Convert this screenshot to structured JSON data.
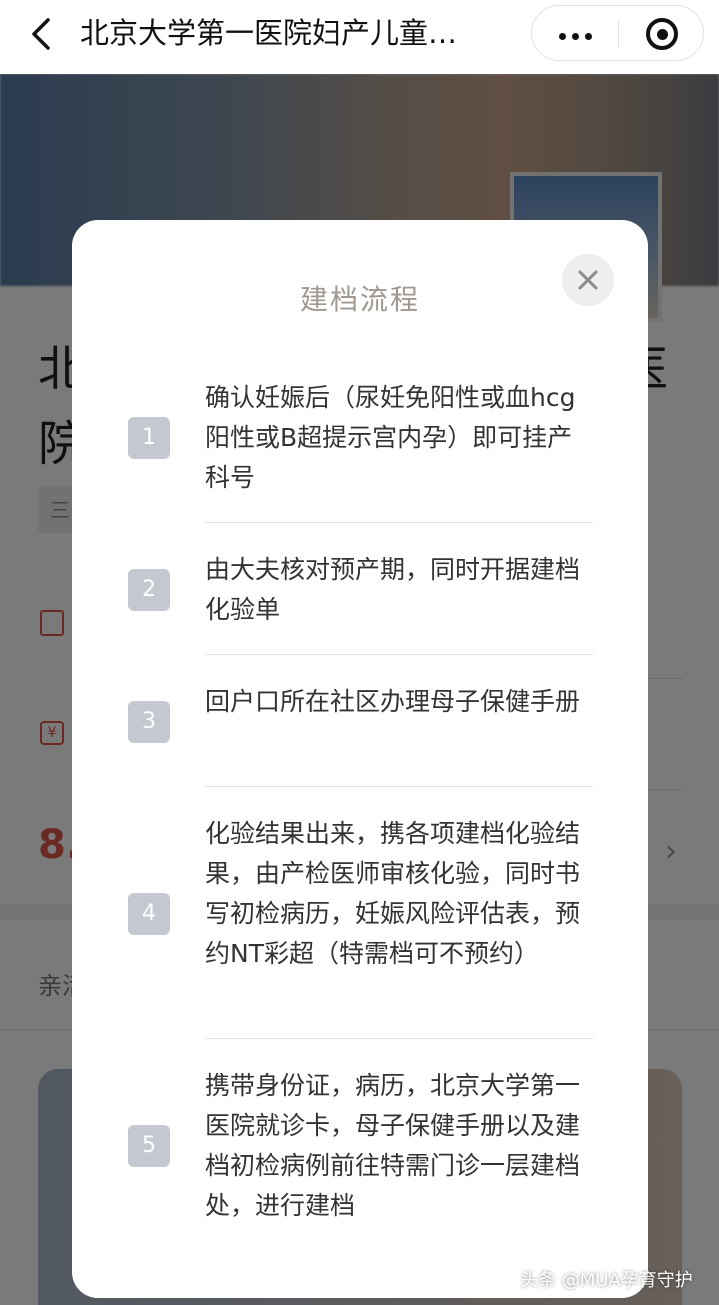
{
  "navbar": {
    "title": "北京大学第一医院妇产儿童…"
  },
  "background": {
    "title_line1": "北",
    "title_line2": "院",
    "title_right": "医",
    "tag": "三",
    "yen_icon": "¥",
    "price": "8.",
    "chevron": "›",
    "section_text": "亲活"
  },
  "modal": {
    "title": "建档流程",
    "steps": [
      {
        "number": "1",
        "text": "确认妊娠后（尿妊免阳性或血hcg阳性或B超提示宫内孕）即可挂产科号"
      },
      {
        "number": "2",
        "text": "由大夫核对预产期，同时开据建档化验单"
      },
      {
        "number": "3",
        "text": "回户口所在社区办理母子保健手册"
      },
      {
        "number": "4",
        "text": "化验结果出来，携各项建档化验结果，由产检医师审核化验，同时书写初检病历，妊娠风险评估表，预约NT彩超（特需档可不预约）"
      },
      {
        "number": "5",
        "text": "携带身份证，病历，北京大学第一医院就诊卡，母子保健手册以及建档初检病例前往特需门诊一层建档处，进行建档"
      }
    ]
  },
  "watermark": "头条 @MUA孕育守护",
  "icons": {
    "back": "chevron-left-icon",
    "more": "more-dots-icon",
    "mini_program_close": "target-icon",
    "modal_close": "close-icon"
  },
  "colors": {
    "price_accent": "#e0574b",
    "step_badge": "#c4c8d0",
    "modal_title": "#a09890"
  }
}
